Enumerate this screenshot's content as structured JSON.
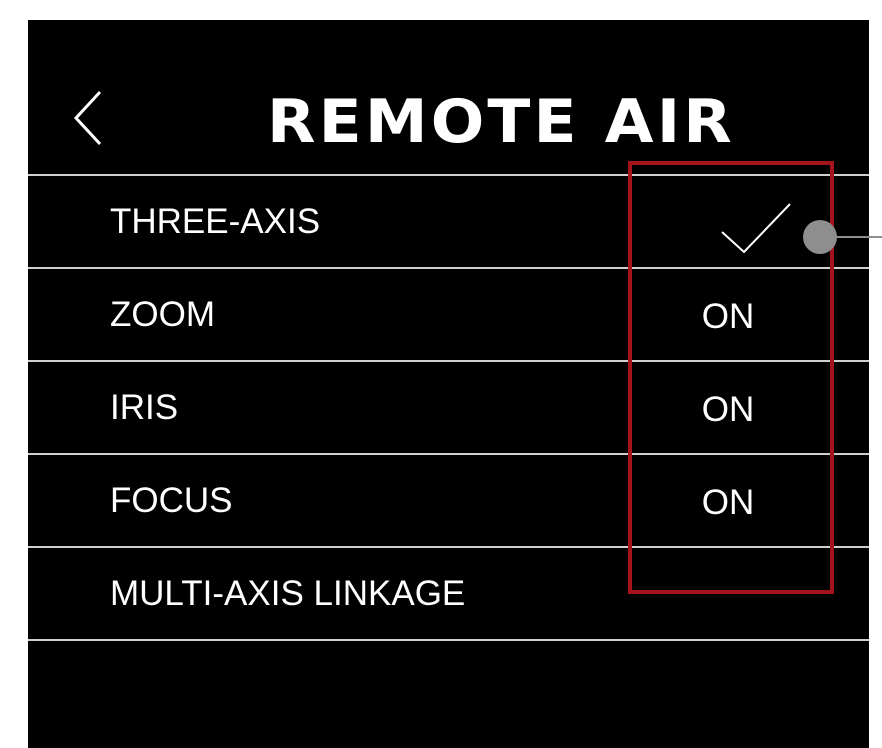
{
  "header": {
    "title": "REMOTE AIR",
    "back_icon": "chevron-left-icon"
  },
  "menu": {
    "items": [
      {
        "label": "THREE-AXIS",
        "value": "",
        "icon": "checkmark-icon",
        "checked": true
      },
      {
        "label": "ZOOM",
        "value": "ON"
      },
      {
        "label": "IRIS",
        "value": "ON"
      },
      {
        "label": "FOCUS",
        "value": "ON"
      },
      {
        "label": "MULTI-AXIS LINKAGE",
        "value": ""
      }
    ]
  },
  "annotation": {
    "highlight_color": "#a5141c",
    "callout_color": "#8e8e8e"
  }
}
